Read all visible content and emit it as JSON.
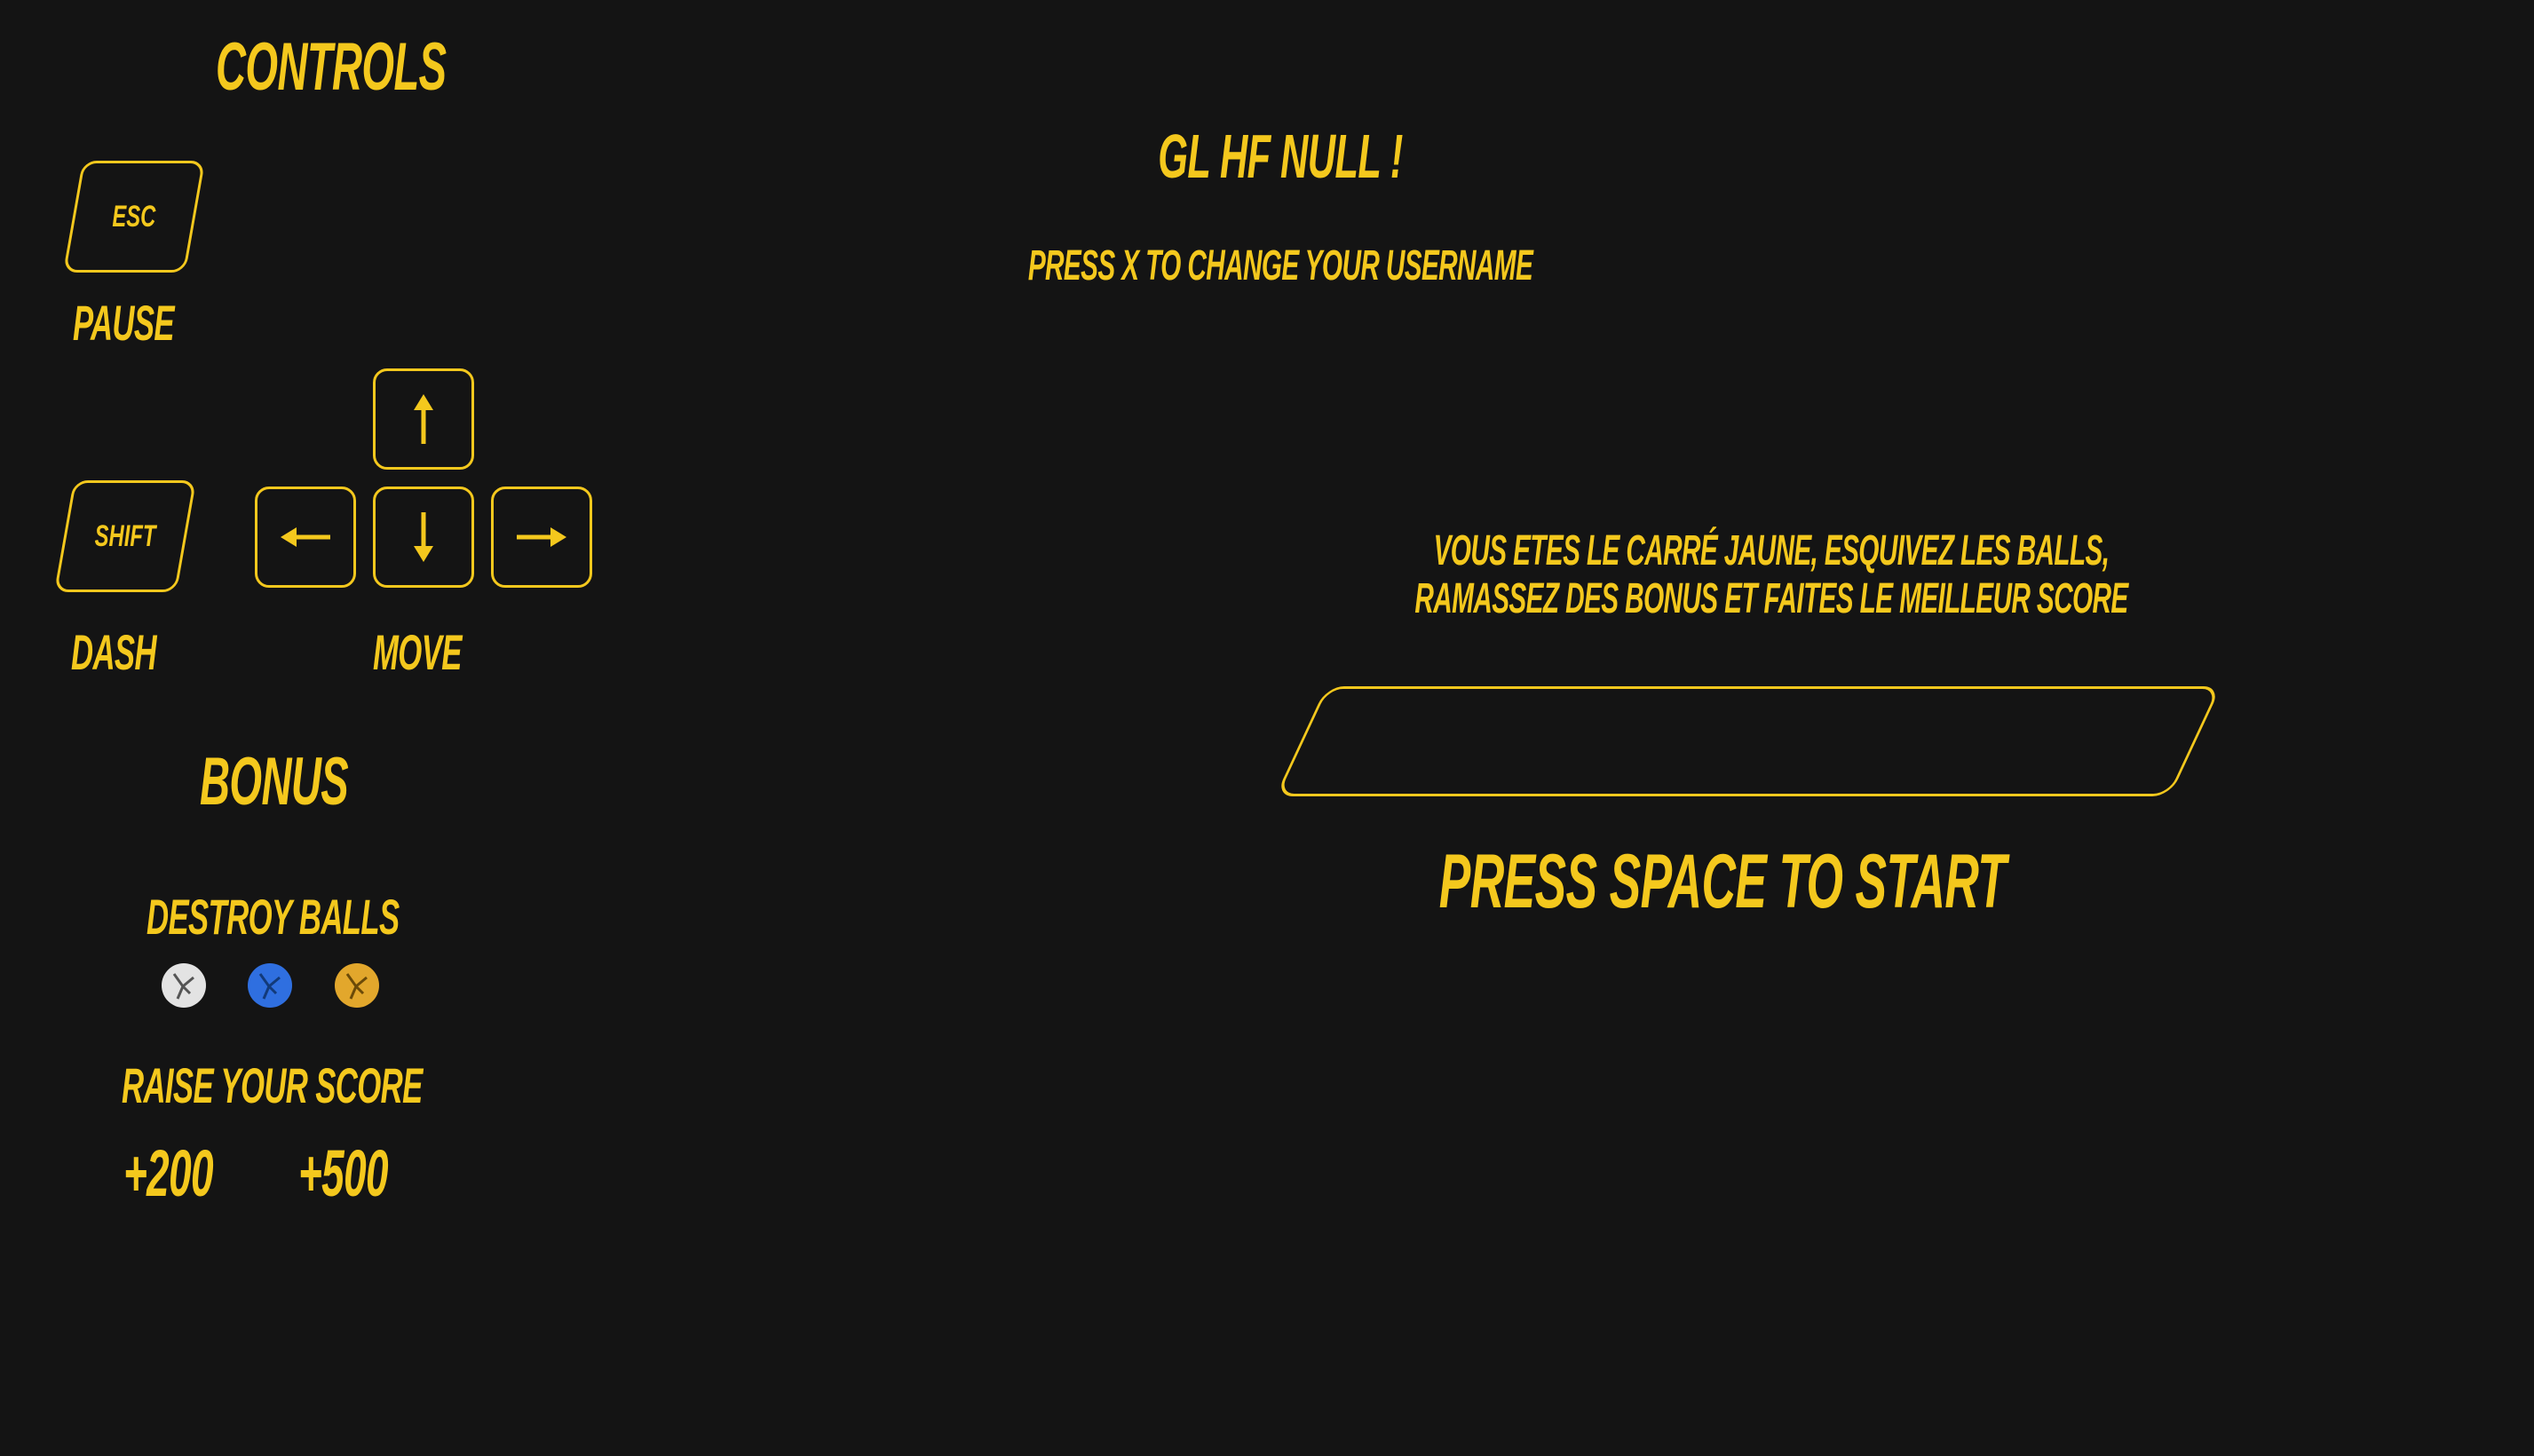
{
  "controls": {
    "title": "Controls",
    "esc_key": "ESC",
    "pause_label": "Pause",
    "shift_key": "SHIFT",
    "dash_label": "Dash",
    "move_label": "Move",
    "arrow_icons": [
      "arrow-up-icon",
      "arrow-left-icon",
      "arrow-down-icon",
      "arrow-right-icon"
    ]
  },
  "bonus": {
    "title": "Bonus",
    "destroy_label": "Destroy Balls",
    "ball_colors": [
      "#e3e3e3",
      "#2f6fe0",
      "#e2a72c"
    ],
    "raise_label": "Raise your score",
    "score_values": [
      "+200",
      "+500"
    ]
  },
  "greeting": {
    "title": "GL HF null !",
    "change_username_hint": "Press X to change your username"
  },
  "instructions": {
    "line1": "Vous etes le carré jaune, esquivez les balls,",
    "line2": "ramassez des bonus et faites le meilleur score"
  },
  "username_input": {
    "value": ""
  },
  "start_prompt": "Press space to start",
  "colors": {
    "background": "#141414",
    "accent": "#f4c81d"
  }
}
